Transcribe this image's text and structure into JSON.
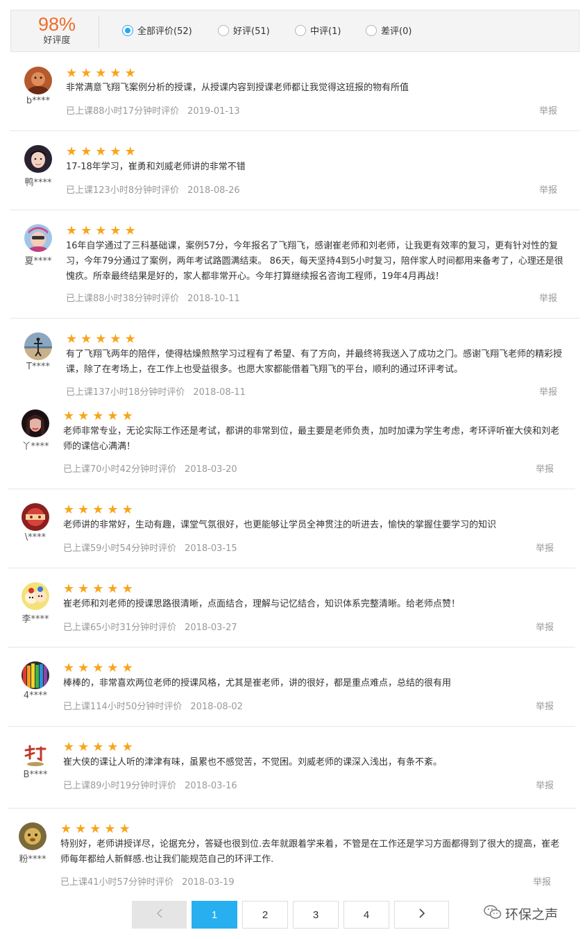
{
  "summary": {
    "rate_value": "98%",
    "rate_label": "好评度",
    "filters": [
      {
        "label": "全部评价(52)",
        "checked": true
      },
      {
        "label": "好评(51)",
        "checked": false
      },
      {
        "label": "中评(1)",
        "checked": false
      },
      {
        "label": "差评(0)",
        "checked": false
      }
    ]
  },
  "reviews": [
    {
      "user": "b****",
      "rating": 5,
      "content": "非常满意飞翔飞案例分析的授课，从授课内容到授课老师都让我觉得这班报的物有所值",
      "duration": "已上课88小时17分钟时评价",
      "date": "2019-01-13",
      "report": "举报"
    },
    {
      "user": "鸭****",
      "rating": 5,
      "content": "17-18年学习，崔勇和刘威老师讲的非常不错",
      "duration": "已上课123小时8分钟时评价",
      "date": "2018-08-26",
      "report": "举报"
    },
    {
      "user": "夏****",
      "rating": 5,
      "content": "16年自学通过了三科基础课，案例57分，今年报名了飞翔飞，感谢崔老师和刘老师，让我更有效率的复习，更有针对性的复习，今年79分通过了案例，两年考试路圆满结束。 86天，每天坚持4到5小时复习，陪伴家人时间都用来备考了，心理还是很愧疚。所幸最终结果是好的，家人都非常开心。今年打算继续报名咨询工程师，19年4月再战！",
      "duration": "已上课88小时38分钟时评价",
      "date": "2018-10-11",
      "report": "举报"
    },
    {
      "user": "T****",
      "rating": 5,
      "content": "有了飞翔飞两年的陪伴，使得枯燥煎熬学习过程有了希望、有了方向，并最终将我送入了成功之门。感谢飞翔飞老师的精彩授课，除了在考场上，在工作上也受益很多。也愿大家都能借着飞翔飞的平台，顺利的通过环评考试。",
      "duration": "已上课137小时18分钟时评价",
      "date": "2018-08-11",
      "report": "举报"
    },
    {
      "user": "丫****",
      "rating": 5,
      "content": "老师非常专业，无论实际工作还是考试，都讲的非常到位，最主要是老师负责，加时加课为学生考虑，考环评听崔大侠和刘老师的课信心满满！",
      "duration": "已上课70小时42分钟时评价",
      "date": "2018-03-20",
      "report": "举报"
    },
    {
      "user": "\\****",
      "rating": 5,
      "content": "老师讲的非常好，生动有趣，课堂气氛很好，也更能够让学员全神贯注的听进去，愉快的掌握住要学习的知识",
      "duration": "已上课59小时54分钟时评价",
      "date": "2018-03-15",
      "report": "举报"
    },
    {
      "user": "李****",
      "rating": 5,
      "content": "崔老师和刘老师的授课思路很清晰，点面结合，理解与记忆结合，知识体系完整清晰。给老师点赞！",
      "duration": "已上课65小时31分钟时评价",
      "date": "2018-03-27",
      "report": "举报"
    },
    {
      "user": "4****",
      "rating": 5,
      "content": "棒棒的，非常喜欢两位老师的授课风格，尤其是崔老师，讲的很好，都是重点难点，总结的很有用",
      "duration": "已上课114小时50分钟时评价",
      "date": "2018-08-02",
      "report": "举报"
    },
    {
      "user": "B****",
      "rating": 5,
      "content": "崔大侠的课让人听的津津有味，虽累也不感觉苦，不觉困。刘威老师的课深入浅出，有条不紊。",
      "duration": "已上课89小时19分钟时评价",
      "date": "2018-03-16",
      "report": "举报"
    },
    {
      "user": "粉****",
      "rating": 5,
      "content": "特别好，老师讲授详尽，论据充分，答疑也很到位.去年就跟着学来着，不管是在工作还是学习方面都得到了很大的提高，崔老师每年都给人新鲜感.也让我们能规范自己的环评工作.",
      "duration": "已上课41小时57分钟时评价",
      "date": "2018-03-19",
      "report": "举报"
    }
  ],
  "pagination": {
    "prev_icon": "chevron-left-icon",
    "pages": [
      "1",
      "2",
      "3",
      "4"
    ],
    "current": "1",
    "next_icon": "chevron-right-icon"
  },
  "watermark": {
    "text": "环保之声",
    "icon": "wechat-icon"
  },
  "colors": {
    "accent": "#2aa6ef",
    "star": "#f8a51b",
    "rate": "#f26b2b",
    "page_active": "#27aff0"
  }
}
